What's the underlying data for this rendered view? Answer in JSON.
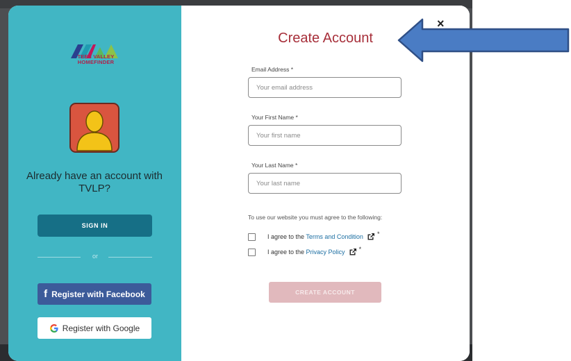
{
  "brand": {
    "logo_line1": "TEES VALLEY",
    "logo_line2": "HOMEFINDER"
  },
  "left": {
    "prompt": "Already have an account with TVLP?",
    "signin_label": "SIGN IN",
    "or_label": "or",
    "facebook_label": "Register with Facebook",
    "google_label": "Register with Google"
  },
  "form": {
    "title": "Create Account",
    "close_glyph": "×",
    "email_label": "Email Address *",
    "email_placeholder": "Your email address",
    "first_label": "Your First Name *",
    "first_placeholder": "Your first name",
    "last_label": "Your Last Name *",
    "last_placeholder": "Your last name",
    "agree_note": "To use our website you must agree to the following:",
    "terms_prefix": "I agree to the ",
    "terms_link": "Terms and Condition",
    "privacy_prefix": "I agree to the ",
    "privacy_link": "Privacy Policy",
    "required_mark": "*",
    "submit_label": "CREATE ACCOUNT"
  },
  "colors": {
    "panel_teal": "#41b6c4",
    "signin_button": "#166f86",
    "facebook_blue": "#3c5b9a",
    "title_red": "#a72f3a",
    "submit_disabled": "#e1b9bd",
    "arrow_blue": "#4a7cc4"
  },
  "icons": {
    "close": "close-icon",
    "external_link": "external-link-icon",
    "facebook": "facebook-icon",
    "google": "google-icon",
    "avatar": "user-avatar-icon",
    "annotation_arrow": "left-arrow-annotation"
  }
}
